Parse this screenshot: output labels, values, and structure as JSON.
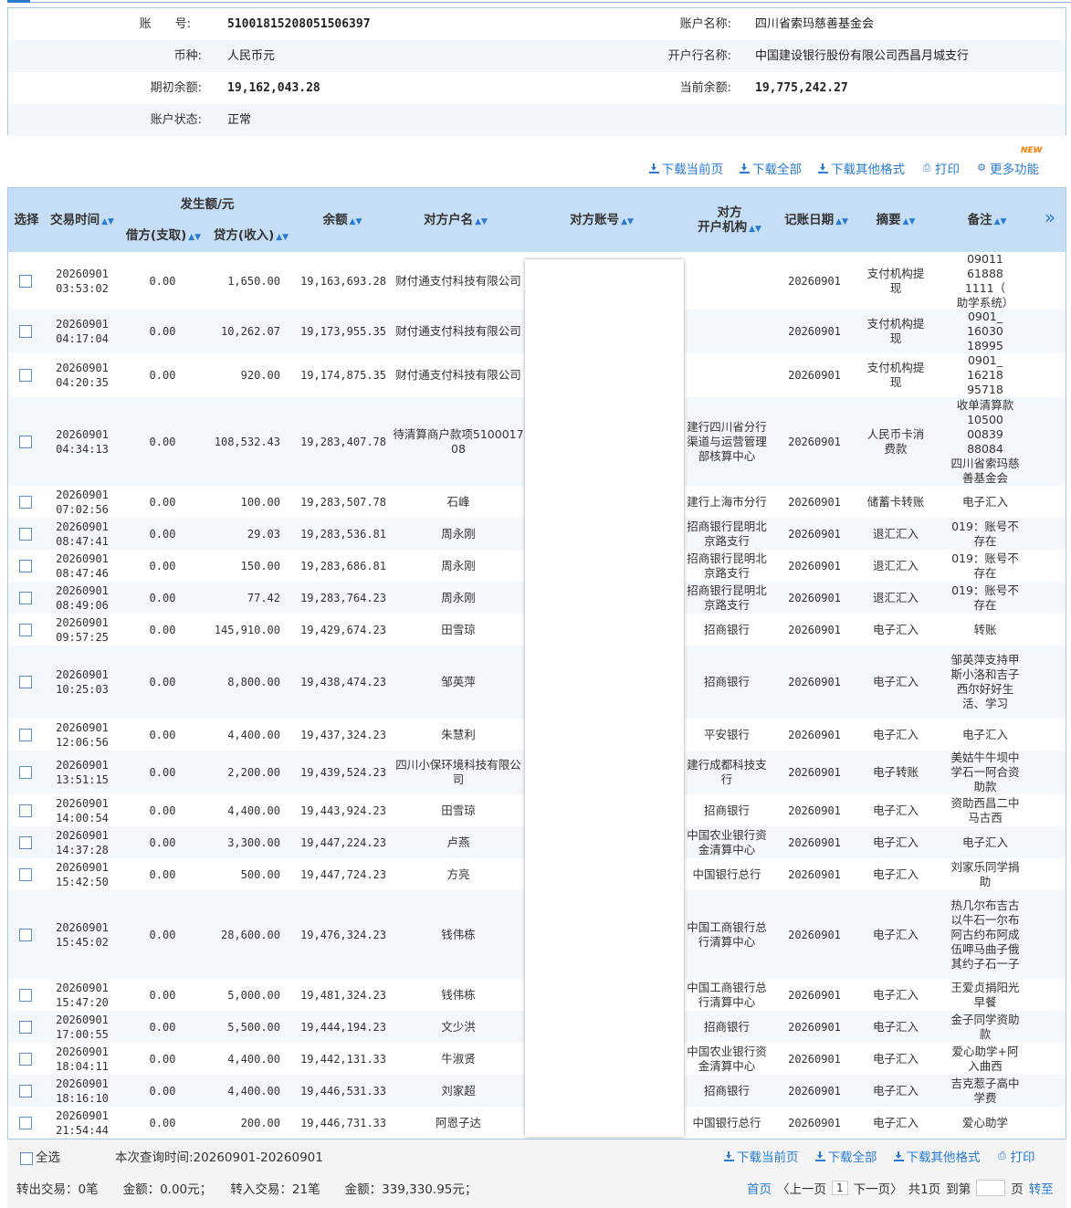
{
  "account": {
    "no_label": "账　　号:",
    "no_value": "51001815208051506397",
    "name_label": "账户名称:",
    "name_value": "四川省索玛慈善基金会",
    "currency_label": "币种:",
    "currency_value": "人民币元",
    "bank_label": "开户行名称:",
    "bank_value": "中国建设银行股份有限公司西昌月城支行",
    "open_balance_label": "期初余额:",
    "open_balance_value": "19,162,043.28",
    "current_balance_label": "当前余额:",
    "current_balance_value": "19,775,242.27",
    "status_label": "账户状态:",
    "status_value": "正常"
  },
  "toolbar": {
    "download_page": "下载当前页",
    "download_all": "下载全部",
    "download_other": "下载其他格式",
    "print": "打印",
    "more": "更多功能",
    "new_badge": "NEW"
  },
  "table": {
    "headers": {
      "select": "选择",
      "time": "交易时间",
      "amount_group": "发生额/元",
      "debit": "借方(支取)",
      "credit": "贷方(收入)",
      "balance": "余额",
      "party_name": "对方户名",
      "party_account": "对方账号",
      "party_bank": "对方\n开户机构",
      "post_date": "记账日期",
      "summary": "摘要",
      "remark": "备注",
      "expand": "»"
    },
    "rows": [
      {
        "time": "20260901\n03:53:02",
        "debit": "0.00",
        "credit": "1,650.00",
        "balance": "19,163,693.28",
        "name": "财付通支付科技有限公司",
        "bank": "",
        "date": "20260901",
        "summary": "支付机构提现",
        "remark": "09011\n61888\n1111（\n助学系统）"
      },
      {
        "time": "20260901\n04:17:04",
        "debit": "0.00",
        "credit": "10,262.07",
        "balance": "19,173,955.35",
        "name": "财付通支付科技有限公司",
        "bank": "",
        "date": "20260901",
        "summary": "支付机构提现",
        "remark": "0901_\n16030\n18995"
      },
      {
        "time": "20260901\n04:20:35",
        "debit": "0.00",
        "credit": "920.00",
        "balance": "19,174,875.35",
        "name": "财付通支付科技有限公司",
        "bank": "",
        "date": "20260901",
        "summary": "支付机构提现",
        "remark": "0901_\n16218\n95718"
      },
      {
        "time": "20260901\n04:34:13",
        "debit": "0.00",
        "credit": "108,532.43",
        "balance": "19,283,407.78",
        "name": "待清算商户款项510001708",
        "bank": "建行四川省分行渠道与运营管理部核算中心",
        "date": "20260901",
        "summary": "人民币卡消费款",
        "remark": "收单清算款\n10500\n00839\n88084\n四川省索玛慈善基金会"
      },
      {
        "time": "20260901\n07:02:56",
        "debit": "0.00",
        "credit": "100.00",
        "balance": "19,283,507.78",
        "name": "石峰",
        "bank": "建行上海市分行",
        "date": "20260901",
        "summary": "储蓄卡转账",
        "remark": "电子汇入"
      },
      {
        "time": "20260901\n08:47:41",
        "debit": "0.00",
        "credit": "29.03",
        "balance": "19,283,536.81",
        "name": "周永刚",
        "bank": "招商银行昆明北京路支行",
        "date": "20260901",
        "summary": "退汇汇入",
        "remark": "019：账号不存在"
      },
      {
        "time": "20260901\n08:47:46",
        "debit": "0.00",
        "credit": "150.00",
        "balance": "19,283,686.81",
        "name": "周永刚",
        "bank": "招商银行昆明北京路支行",
        "date": "20260901",
        "summary": "退汇汇入",
        "remark": "019：账号不存在"
      },
      {
        "time": "20260901\n08:49:06",
        "debit": "0.00",
        "credit": "77.42",
        "balance": "19,283,764.23",
        "name": "周永刚",
        "bank": "招商银行昆明北京路支行",
        "date": "20260901",
        "summary": "退汇汇入",
        "remark": "019：账号不存在"
      },
      {
        "time": "20260901\n09:57:25",
        "debit": "0.00",
        "credit": "145,910.00",
        "balance": "19,429,674.23",
        "name": "田雪琼",
        "bank": "招商银行",
        "date": "20260901",
        "summary": "电子汇入",
        "remark": "转账"
      },
      {
        "time": "20260901\n10:25:03",
        "debit": "0.00",
        "credit": "8,800.00",
        "balance": "19,438,474.23",
        "name": "邹英萍",
        "bank": "招商银行",
        "date": "20260901",
        "summary": "电子汇入",
        "remark": "邹英萍支持甲斯小洛和吉子西尔好好生活、学习"
      },
      {
        "time": "20260901\n12:06:56",
        "debit": "0.00",
        "credit": "4,400.00",
        "balance": "19,437,324.23",
        "name": "朱慧利",
        "bank": "平安银行",
        "date": "20260901",
        "summary": "电子汇入",
        "remark": "电子汇入"
      },
      {
        "time": "20260901\n13:51:15",
        "debit": "0.00",
        "credit": "2,200.00",
        "balance": "19,439,524.23",
        "name": "四川小保环境科技有限公司",
        "bank": "建行成都科技支行",
        "date": "20260901",
        "summary": "电子转账",
        "remark": "美姑牛牛坝中学石一阿合资助款"
      },
      {
        "time": "20260901\n14:00:54",
        "debit": "0.00",
        "credit": "4,400.00",
        "balance": "19,443,924.23",
        "name": "田雪琼",
        "bank": "招商银行",
        "date": "20260901",
        "summary": "电子汇入",
        "remark": "资助西昌二中马古西"
      },
      {
        "time": "20260901\n14:37:28",
        "debit": "0.00",
        "credit": "3,300.00",
        "balance": "19,447,224.23",
        "name": "卢燕",
        "bank": "中国农业银行资金清算中心",
        "date": "20260901",
        "summary": "电子汇入",
        "remark": "电子汇入"
      },
      {
        "time": "20260901\n15:42:50",
        "debit": "0.00",
        "credit": "500.00",
        "balance": "19,447,724.23",
        "name": "方亮",
        "bank": "中国银行总行",
        "date": "20260901",
        "summary": "电子汇入",
        "remark": "刘家乐同学捐助"
      },
      {
        "time": "20260901\n15:45:02",
        "debit": "0.00",
        "credit": "28,600.00",
        "balance": "19,476,324.23",
        "name": "钱伟栋",
        "bank": "中国工商银行总行清算中心",
        "date": "20260901",
        "summary": "电子汇入",
        "remark": "热几尔布吉古以牛石一尔布阿古约布阿成伍呷马曲子俄其约子石一子"
      },
      {
        "time": "20260901\n15:47:20",
        "debit": "0.00",
        "credit": "5,000.00",
        "balance": "19,481,324.23",
        "name": "钱伟栋",
        "bank": "中国工商银行总行清算中心",
        "date": "20260901",
        "summary": "电子汇入",
        "remark": "王爱贞捐阳光早餐"
      },
      {
        "time": "20260901\n17:00:55",
        "debit": "0.00",
        "credit": "5,500.00",
        "balance": "19,444,194.23",
        "name": "文少洪",
        "bank": "招商银行",
        "date": "20260901",
        "summary": "电子汇入",
        "remark": "金子同学资助款"
      },
      {
        "time": "20260901\n18:04:11",
        "debit": "0.00",
        "credit": "4,400.00",
        "balance": "19,442,131.33",
        "name": "牛淑贤",
        "bank": "中国农业银行资金清算中心",
        "date": "20260901",
        "summary": "电子汇入",
        "remark": "爱心助学+阿入曲西"
      },
      {
        "time": "20260901\n18:16:10",
        "debit": "0.00",
        "credit": "4,400.00",
        "balance": "19,446,531.33",
        "name": "刘家超",
        "bank": "招商银行",
        "date": "20260901",
        "summary": "电子汇入",
        "remark": "吉克惹子高中学费"
      },
      {
        "time": "20260901\n21:54:44",
        "debit": "0.00",
        "credit": "200.00",
        "balance": "19,446,731.33",
        "name": "阿恩子达",
        "bank": "中国银行总行",
        "date": "20260901",
        "summary": "电子汇入",
        "remark": "爱心助学"
      }
    ]
  },
  "footer": {
    "select_all": "全选",
    "query_time": "本次查询时间:20260901-20260901",
    "download_page": "下载当前页",
    "download_all": "下载全部",
    "download_other": "下载其他格式",
    "print": "打印",
    "summary": "转出交易：0笔　　金额：0.00元；　　转入交易：21笔　　金额：339,330.95元；",
    "first": "首页",
    "prev": "〈上一页",
    "page": "1",
    "next": "下一页〉",
    "total": "共1页",
    "goto": "到第",
    "page_unit": "页",
    "go": "转至"
  }
}
